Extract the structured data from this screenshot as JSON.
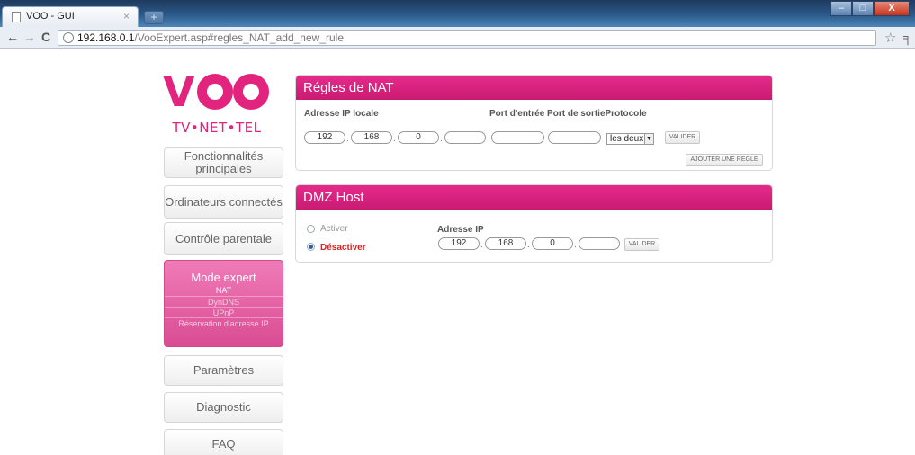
{
  "browser": {
    "tab_title": "VOO - GUI",
    "tab_close": "×",
    "new_tab": "+",
    "url_host": "192.168.0.1",
    "url_path": "/VooExpert.asp#regles_NAT_add_new_rule",
    "window_buttons": {
      "minimize": "–",
      "maximize": "□",
      "close": "X"
    },
    "nav": {
      "back": "←",
      "forward": "→",
      "reload": "C"
    },
    "bookmark_icon": "☆",
    "wrench_icon": "╕"
  },
  "logo": {
    "tagline": "TV•NET•TEL"
  },
  "menu": {
    "items_top": [
      "Fonctionnalités principales",
      "Ordinateurs connectés",
      "Contrôle parentale"
    ],
    "expert": {
      "title": "Mode expert",
      "subitems": [
        "NAT",
        "DynDNS",
        "UPnP",
        "Réservation d'adresse IP"
      ],
      "active_subitem": "NAT"
    },
    "items_bottom": [
      "Paramètres",
      "Diagnostic",
      "FAQ"
    ]
  },
  "nat_panel": {
    "title": "Régles de NAT",
    "labels": {
      "local_ip": "Adresse IP locale",
      "ports_protocol": "Port d'entrée Port de sortieProtocole"
    },
    "ip_fields": [
      "192",
      "168",
      "0",
      ""
    ],
    "port_in": "",
    "port_out": "",
    "protocol": "les deux",
    "validate_button": "VALIDER",
    "add_rule_button": "AJOUTER UNE REGLE"
  },
  "dmz_panel": {
    "title": "DMZ Host",
    "radio_activate": "Activer",
    "radio_deactivate": "Désactiver",
    "selected": "Désactiver",
    "ip_label": "Adresse IP",
    "ip_fields": [
      "192",
      "168",
      "0",
      ""
    ],
    "validate_button": "VALIDER"
  },
  "colors": {
    "brand": "#e2247f",
    "header": "#d61f7e"
  }
}
